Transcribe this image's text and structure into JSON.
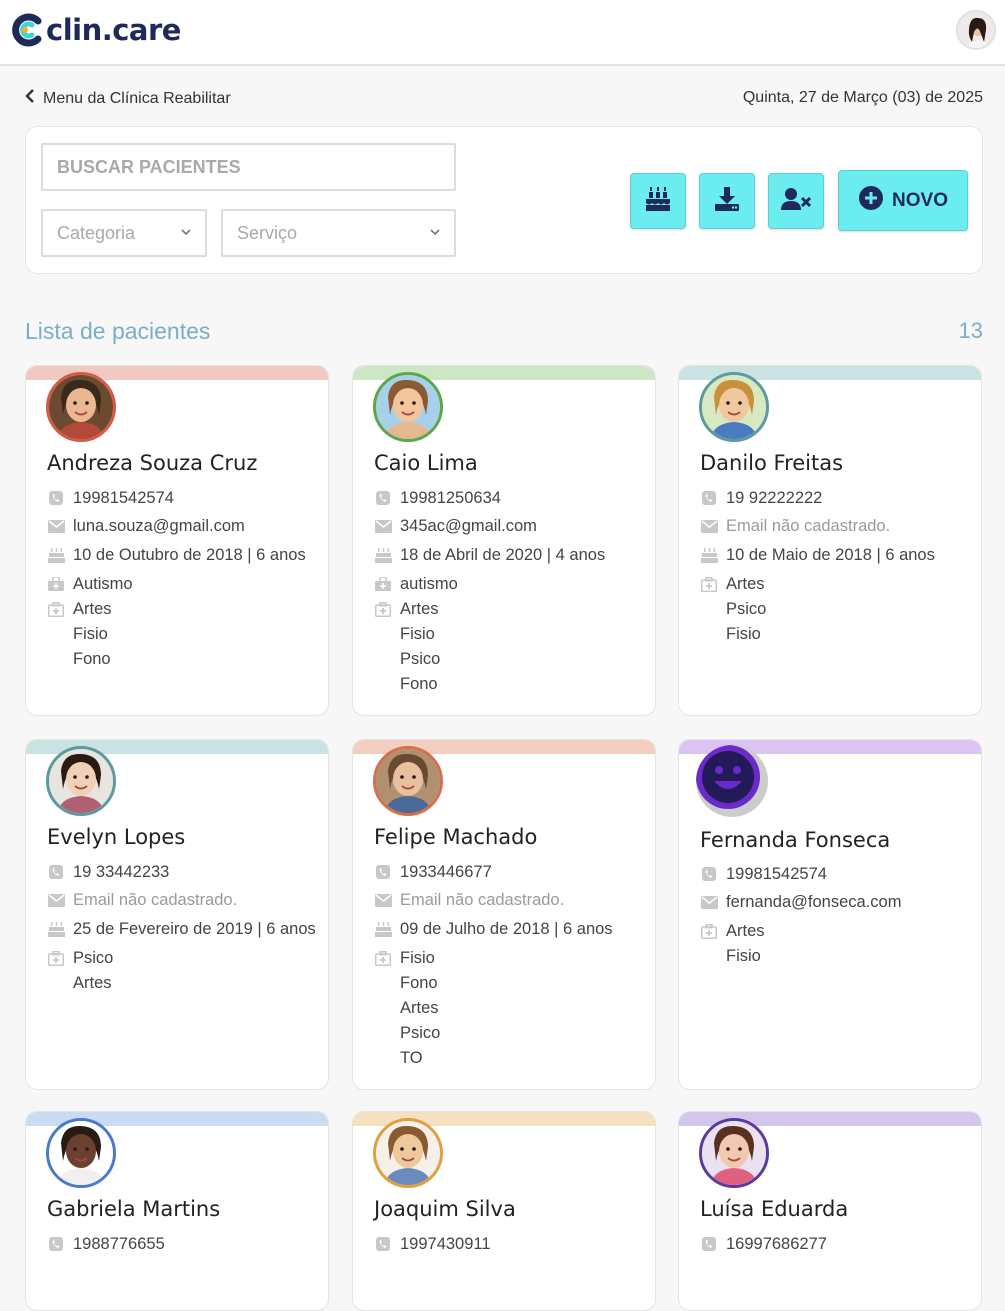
{
  "header": {
    "logo_text": "clin.care",
    "user_avatar_icon": "user-avatar"
  },
  "nav": {
    "back_label": "Menu da Clínica Reabilitar",
    "date": "Quinta, 27 de Março (03) de 2025"
  },
  "filters": {
    "search_placeholder": "BUSCAR PACIENTES",
    "category_label": "Categoria",
    "service_label": "Serviço",
    "actions": [
      {
        "icon": "birthday-cake-icon"
      },
      {
        "icon": "download-icon"
      },
      {
        "icon": "user-remove-icon"
      }
    ],
    "new_label": "NOVO"
  },
  "list": {
    "title": "Lista de pacientes",
    "count": "13"
  },
  "patients": [
    {
      "name": "Andreza Souza Cruz",
      "phone": "19981542574",
      "email": "luna.souza@gmail.com",
      "email_missing": false,
      "birth": "10 de Outubro de 2018 | 6 anos",
      "category": "Autismo",
      "services": [
        "Artes",
        "Fisio",
        "Fono"
      ],
      "band": "#f2c8c3",
      "ring": "#d65a45"
    },
    {
      "name": "Caio Lima",
      "phone": "19981250634",
      "email": "345ac@gmail.com",
      "email_missing": false,
      "birth": "18 de Abril de 2020 | 4 anos",
      "category": "autismo",
      "services": [
        "Artes",
        "Fisio",
        "Psico",
        "Fono"
      ],
      "band": "#cde6c4",
      "ring": "#5aa84a"
    },
    {
      "name": "Danilo Freitas",
      "phone": "19 92222222",
      "email": "Email não cadastrado.",
      "email_missing": true,
      "birth": "10 de Maio de 2018 | 6 anos",
      "category": "",
      "services": [
        "Artes",
        "Psico",
        "Fisio"
      ],
      "band": "#c9e3e3",
      "ring": "#5a9aa0"
    },
    {
      "name": "Evelyn Lopes",
      "phone": "19 33442233",
      "email": "Email não cadastrado.",
      "email_missing": true,
      "birth": "25 de Fevereiro de 2019 | 6 anos",
      "category": "",
      "services": [
        "Psico",
        "Artes"
      ],
      "band": "#c9e3e3",
      "ring": "#5a9aa0"
    },
    {
      "name": "Felipe Machado",
      "phone": "1933446677",
      "email": "Email não cadastrado.",
      "email_missing": true,
      "birth": "09 de Julho de 2018 | 6 anos",
      "category": "",
      "services": [
        "Fisio",
        "Fono",
        "Artes",
        "Psico",
        "TO"
      ],
      "band": "#f2cfc0",
      "ring": "#d4704a"
    },
    {
      "name": "Fernanda Fonseca",
      "phone": "19981542574",
      "email": "fernanda@fonseca.com",
      "email_missing": false,
      "birth": "",
      "category": "",
      "services": [
        "Artes",
        "Fisio"
      ],
      "band": "#dcc4f2",
      "ring": "#6a2bc8"
    },
    {
      "name": "Gabriela Martins",
      "phone": "1988776655",
      "email": "",
      "email_missing": false,
      "birth": "",
      "category": "",
      "services": [],
      "band": "#c9dcf2",
      "ring": "#4a7ad0"
    },
    {
      "name": "Joaquim Silva",
      "phone": "1997430911",
      "email": "",
      "email_missing": false,
      "birth": "",
      "category": "",
      "services": [],
      "band": "#f5e0c0",
      "ring": "#e0a040"
    },
    {
      "name": "Luísa Eduarda",
      "phone": "16997686277",
      "email": "",
      "email_missing": false,
      "birth": "",
      "category": "",
      "services": [],
      "band": "#d3c6ec",
      "ring": "#5a3aa0"
    }
  ],
  "colors": {
    "accent": "#6bedf0",
    "brand_navy": "#1e2a5a",
    "list_title": "#7aaec8"
  }
}
